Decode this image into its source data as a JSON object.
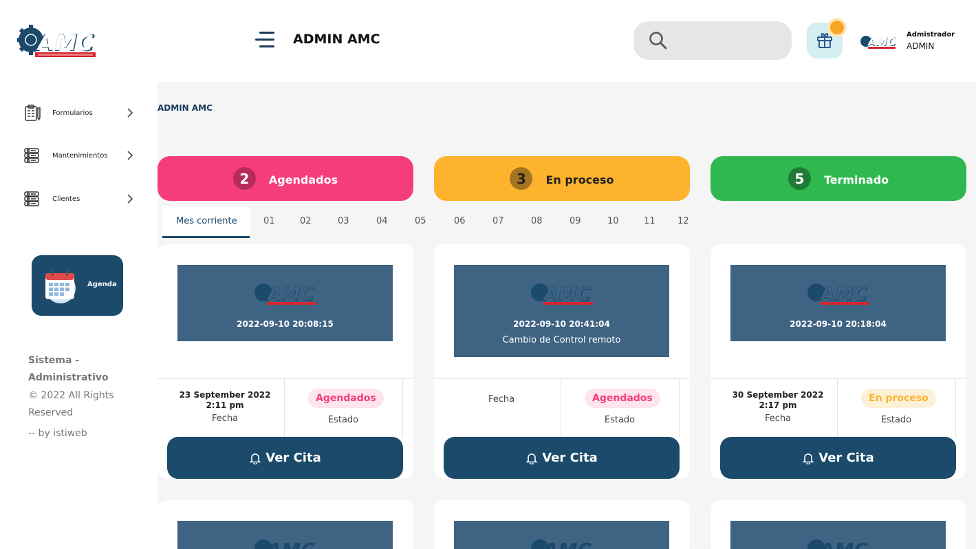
{
  "colors": {
    "navy": "#1b4a6b",
    "pink": "#f53d7a",
    "orange": "#fdb32e",
    "green": "#2fb84f"
  },
  "header": {
    "logo_text": "AMC",
    "app_title": "ADMIN AMC",
    "search_placeholder": "",
    "user_role": "Admistrador",
    "user_name": "ADMIN"
  },
  "sidebar": {
    "items": [
      {
        "label": "Formularios",
        "icon": "clipboard-icon"
      },
      {
        "label": "Mantenimientos",
        "icon": "database-icon"
      },
      {
        "label": "Clientes",
        "icon": "database-icon"
      }
    ],
    "agenda_label": "Agenda",
    "footer_title": "Sistema - Administrativo",
    "footer_rights": "© 2022 All Rights Reserved",
    "footer_by": "-- by istiweb"
  },
  "breadcrumb": "ADMIN AMC",
  "stats": [
    {
      "count": "2",
      "label": "Agendados"
    },
    {
      "count": "3",
      "label": "En proceso"
    },
    {
      "count": "5",
      "label": "Terminado"
    }
  ],
  "tabs": [
    "Mes corriente",
    "01",
    "02",
    "03",
    "04",
    "05",
    "06",
    "07",
    "08",
    "09",
    "10",
    "11",
    "12"
  ],
  "cards": [
    {
      "timestamp": "2022-09-10 20:08:15",
      "description": "",
      "fecha": "23 September 2022 2:11 pm",
      "fecha_label": "Fecha",
      "estado": "Agendados",
      "estado_label": "Estado",
      "button": "Ver Cita"
    },
    {
      "timestamp": "2022-09-10 20:41:04",
      "description": "Cambio de Control remoto",
      "fecha": "",
      "fecha_label": "Fecha",
      "estado": "Agendados",
      "estado_label": "Estado",
      "button": "Ver Cita"
    },
    {
      "timestamp": "2022-09-10 20:18:04",
      "description": "",
      "fecha": "30 September 2022 2:17 pm",
      "fecha_label": "Fecha",
      "estado": "En proceso",
      "estado_label": "Estado",
      "button": "Ver Cita"
    }
  ]
}
